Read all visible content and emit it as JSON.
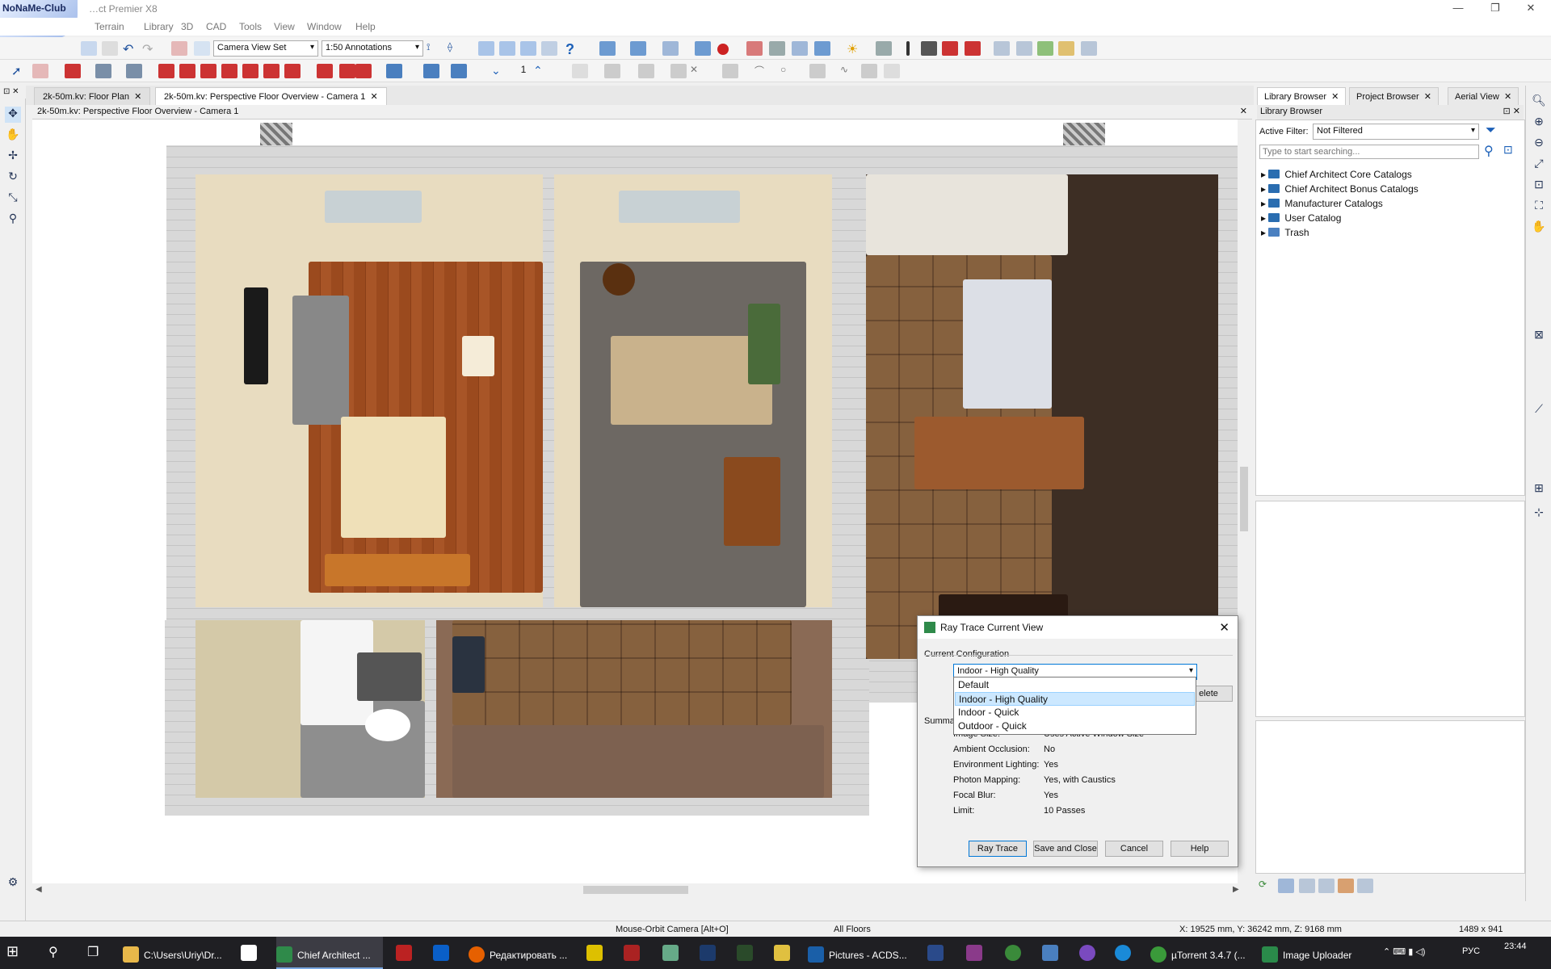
{
  "window": {
    "title": "…ct Premier X8",
    "logo": "NoNaMe-Club"
  },
  "menubar": [
    "Terrain",
    "Library",
    "3D",
    "CAD",
    "Tools",
    "View",
    "Window",
    "Help"
  ],
  "toolbar": {
    "camera_set": "Camera View Set",
    "annotation_set": "1:50 Annotations",
    "number_field": "1"
  },
  "doc_tabs": [
    {
      "label": "2k-50m.kv: Floor Plan"
    },
    {
      "label": "2k-50m.kv: Perspective Floor Overview - Camera 1"
    }
  ],
  "view_title": "2k-50m.kv: Perspective Floor Overview - Camera 1",
  "right_panel": {
    "tabs": [
      "Library Browser",
      "Project Browser",
      "Aerial View"
    ],
    "header": "Library Browser",
    "filter_label": "Active Filter:",
    "filter_value": "Not Filtered",
    "search_placeholder": "Type to start searching...",
    "tree": [
      "Chief Architect Core Catalogs",
      "Chief Architect Bonus Catalogs",
      "Manufacturer Catalogs",
      "User Catalog",
      "Trash"
    ]
  },
  "dialog": {
    "title": "Ray Trace Current View",
    "group_label": "Current Configuration",
    "selected": "Indoor - High Quality",
    "options": [
      "Default",
      "Indoor - High Quality",
      "Indoor - Quick",
      "Outdoor - Quick"
    ],
    "partial_button": "elete",
    "summary_label": "Summar",
    "summary": [
      {
        "label": "Image Size:",
        "value": "Uses Active Window Size"
      },
      {
        "label": "Ambient Occlusion:",
        "value": "No"
      },
      {
        "label": "Environment Lighting:",
        "value": "Yes"
      },
      {
        "label": "Photon Mapping:",
        "value": "Yes, with Caustics"
      },
      {
        "label": "Focal Blur:",
        "value": "Yes"
      },
      {
        "label": "Limit:",
        "value": "10 Passes"
      }
    ],
    "buttons": {
      "ray_trace": "Ray Trace",
      "save_close": "Save and Close",
      "cancel": "Cancel",
      "help": "Help"
    }
  },
  "status": {
    "mode": "Mouse-Orbit Camera [Alt+O]",
    "floors": "All Floors",
    "coords": "X: 19525 mm, Y: 36242 mm, Z: 9168 mm",
    "size": "1489 x 941"
  },
  "taskbar": {
    "items": [
      "C:\\Users\\Uriy\\Dr...",
      "Chief Architect ...",
      "Редактировать ...",
      "Pictures - ACDS...",
      "µTorrent 3.4.7 (...",
      "Image Uploader"
    ],
    "lang": "РУС",
    "time": "23:44"
  },
  "colors": {
    "accent": "#0078d7",
    "folder": "#2a6db0",
    "taskbar": "#1f1f23"
  }
}
